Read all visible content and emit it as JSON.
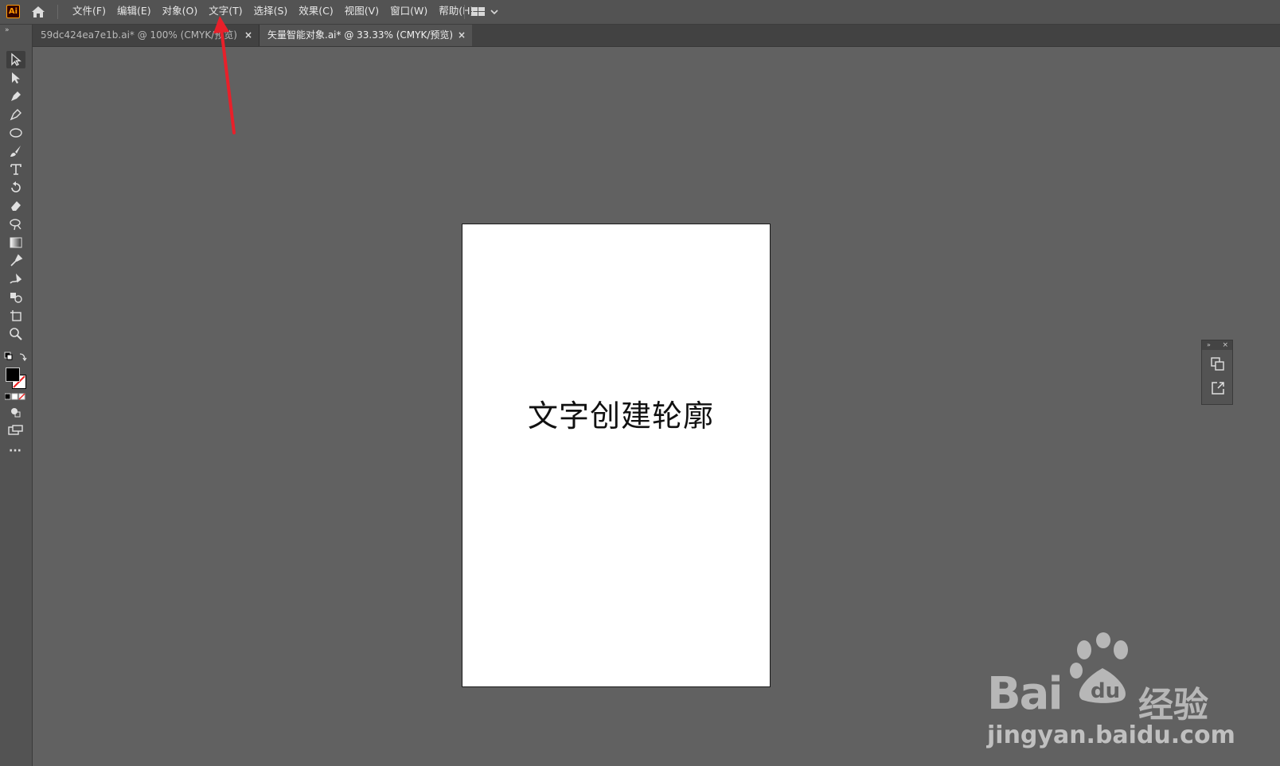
{
  "app": {
    "logo_text": "Ai",
    "accent_color": "#ff9a00"
  },
  "menubar": {
    "items": [
      "文件(F)",
      "编辑(E)",
      "对象(O)",
      "文字(T)",
      "选择(S)",
      "效果(C)",
      "视图(V)",
      "窗口(W)",
      "帮助(H)"
    ]
  },
  "tabs": [
    {
      "label": "59dc424ea7e1b.ai* @ 100% (CMYK/预览)",
      "close": "×",
      "active": false
    },
    {
      "label": "矢量智能对象.ai* @ 33.33% (CMYK/预览)",
      "close": "×",
      "active": true
    }
  ],
  "toolbar": {
    "collapse_glyph": "»",
    "tools": [
      "selection-tool",
      "direct-selection-tool",
      "pen-tool",
      "curvature-tool",
      "ellipse-tool",
      "paintbrush-tool",
      "type-tool",
      "rotate-tool",
      "eraser-tool",
      "lasso-tool",
      "gradient-tool",
      "eyedropper-tool",
      "puppet-warp-tool",
      "shape-builder-tool",
      "artboard-tool",
      "zoom-tool"
    ],
    "more_label": "···"
  },
  "artboard": {
    "text": "文字创建轮廓"
  },
  "floating_panel": {
    "collapse_glyph": "»",
    "close_glyph": "×"
  },
  "watermark": {
    "brand": "Bai",
    "brand_suffix": "经验",
    "url": "jingyan.baidu.com"
  },
  "annotation": {
    "color": "#e8202a"
  }
}
